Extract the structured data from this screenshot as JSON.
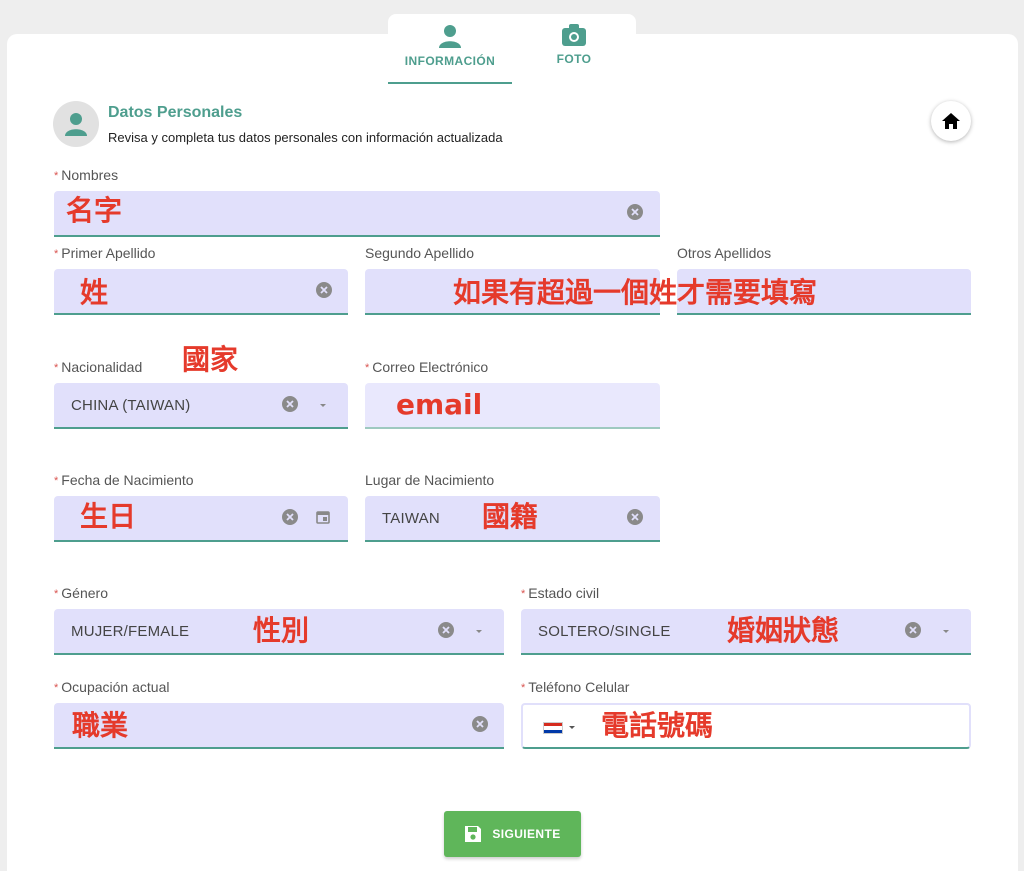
{
  "tabs": [
    {
      "label": "INFORMACIÓN",
      "icon": "person-icon",
      "active": true
    },
    {
      "label": "FOTO",
      "icon": "camera-icon",
      "active": false
    }
  ],
  "section": {
    "title": "Datos Personales",
    "subtitle": "Revisa y completa tus datos personales con información actualizada"
  },
  "required_mark": "*",
  "fields": {
    "nombres": {
      "label": "Nombres",
      "value": ""
    },
    "primer_apellido": {
      "label": "Primer Apellido",
      "value": ""
    },
    "segundo_apellido": {
      "label": "Segundo Apellido",
      "value": ""
    },
    "otros_apellidos": {
      "label": "Otros Apellidos",
      "value": ""
    },
    "nacionalidad": {
      "label": "Nacionalidad",
      "value": "CHINA (TAIWAN)"
    },
    "correo": {
      "label": "Correo Electrónico",
      "value": ""
    },
    "fecha_nacimiento": {
      "label": "Fecha de Nacimiento",
      "value": ""
    },
    "lugar_nacimiento": {
      "label": "Lugar de Nacimiento",
      "value": "TAIWAN"
    },
    "genero": {
      "label": "Género",
      "value": "MUJER/FEMALE"
    },
    "estado_civil": {
      "label": "Estado civil",
      "value": "SOLTERO/SINGLE"
    },
    "ocupacion": {
      "label": "Ocupación actual",
      "value": ""
    },
    "telefono": {
      "label": "Teléfono Celular",
      "value": ""
    }
  },
  "annotations": {
    "nombres": "名字",
    "primer_apellido": "姓",
    "segundo_apellido": "如果有超過一個姓才需要填寫",
    "nacionalidad": "國家",
    "correo": "email",
    "fecha_nacimiento": "生日",
    "lugar_nacimiento": "國籍",
    "genero": "性別",
    "estado_civil": "婚姻狀態",
    "ocupacion": "職業",
    "telefono": "電話號碼"
  },
  "save_button": {
    "label": "SIGUIENTE",
    "icon": "save-icon"
  },
  "colors": {
    "accent": "#4e9e8e",
    "field_bg": "#e1e0fb",
    "annotation": "#e53a2b",
    "save_button": "#5fb65a"
  }
}
